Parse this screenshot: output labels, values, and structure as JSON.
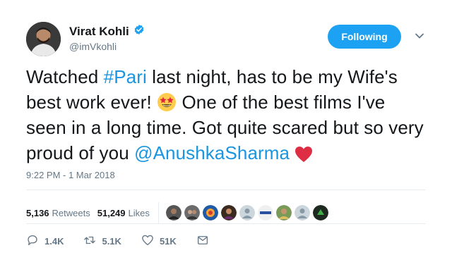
{
  "author": {
    "name": "Virat Kohli",
    "handle": "@imVkohli",
    "verified": true
  },
  "follow_button": {
    "label": "Following",
    "color": "#1da1f2"
  },
  "tweet": {
    "part1": "Watched ",
    "hashtag": "#Pari",
    "part2": " last night, has to be my Wife's best work ever! ",
    "emoji": "star-struck-emoji",
    "part3": " One of the best films I've seen in a long time. Got quite scared but so very proud of you ",
    "mention": "@AnushkaSharma",
    "heart": "red-heart-emoji"
  },
  "timestamp": "9:22 PM - 1 Mar 2018",
  "stats": {
    "retweets_count": "5,136",
    "retweets_label": "Retweets",
    "likes_count": "51,249",
    "likes_label": "Likes"
  },
  "actions": {
    "reply_count": "1.4K",
    "retweet_count": "5.1K",
    "like_count": "51K"
  },
  "colors": {
    "link": "#1b95e0",
    "secondary_text": "#657786",
    "divider": "#e6ecf0"
  }
}
